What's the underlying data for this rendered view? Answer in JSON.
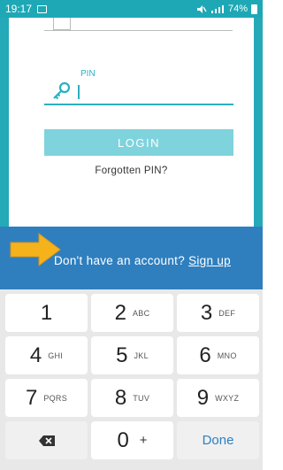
{
  "status_bar": {
    "time": "19:17",
    "battery": "74%"
  },
  "pin_field": {
    "label": "PIN"
  },
  "login_button": "LOGIN",
  "forgot_link": "Forgotten PIN?",
  "signup": {
    "prompt": "Don't have an account? ",
    "link": "Sign up"
  },
  "keypad": {
    "rows": [
      [
        {
          "num": "1",
          "sub": ""
        },
        {
          "num": "2",
          "sub": "ABC"
        },
        {
          "num": "3",
          "sub": "DEF"
        }
      ],
      [
        {
          "num": "4",
          "sub": "GHI"
        },
        {
          "num": "5",
          "sub": "JKL"
        },
        {
          "num": "6",
          "sub": "MNO"
        }
      ],
      [
        {
          "num": "7",
          "sub": "PQRS"
        },
        {
          "num": "8",
          "sub": "TUV"
        },
        {
          "num": "9",
          "sub": "WXYZ"
        }
      ]
    ],
    "zero": "0",
    "plus": "+",
    "done": "Done"
  },
  "colors": {
    "teal": "#24a9b8",
    "blue_band": "#2f7fbf",
    "login_button": "#7fd3dc",
    "arrow": "#f5b21b"
  },
  "icons": {
    "key": "key-icon",
    "backspace": "backspace-icon",
    "arrow": "arrow-pointer-icon"
  }
}
